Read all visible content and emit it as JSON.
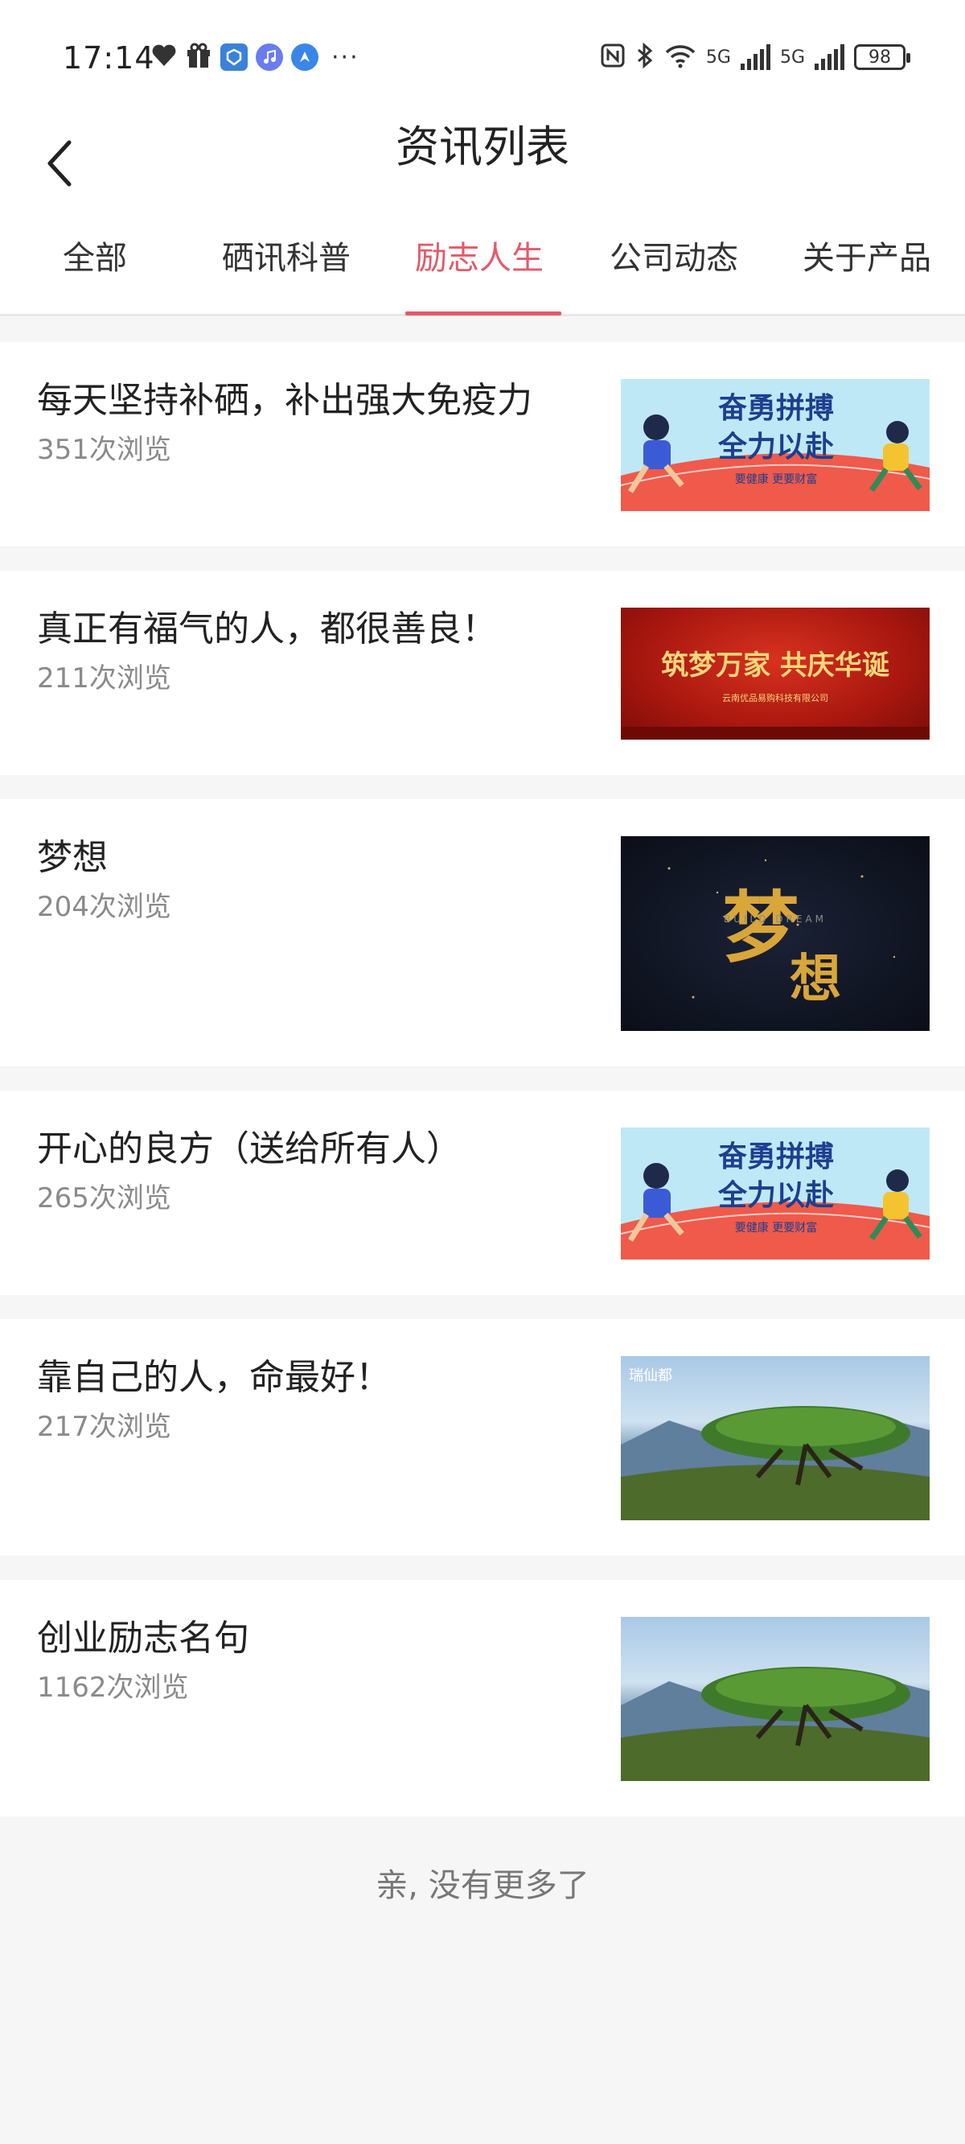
{
  "status_bar": {
    "time": "17:14",
    "battery": "98",
    "net1": "5G",
    "net2": "5G",
    "dots": "···",
    "icons": [
      "heart-icon",
      "gift-icon",
      "app-icon",
      "music-icon",
      "compass-icon",
      "nfc-icon",
      "bluetooth-icon",
      "wifi-icon",
      "signal-icon",
      "battery-icon"
    ]
  },
  "header": {
    "title": "资讯列表",
    "back_icon": "chevron-left-icon"
  },
  "tabs": [
    {
      "label": "全部",
      "active": false
    },
    {
      "label": "硒讯科普",
      "active": false
    },
    {
      "label": "励志人生",
      "active": true
    },
    {
      "label": "公司动态",
      "active": false
    },
    {
      "label": "关于产品",
      "active": false
    }
  ],
  "articles": [
    {
      "title": "每天坚持补硒，补出强大免疫力",
      "views": "351次浏览",
      "thumb": "sport",
      "thumb_text": [
        "奋勇拼搏",
        "全力以赴"
      ],
      "thumb_sub": "要健康    更要财富"
    },
    {
      "title": "真正有福气的人，都很善良！",
      "views": "211次浏览",
      "thumb": "red",
      "thumb_text": [
        "筑梦万家  共庆华诞"
      ],
      "thumb_sub": "云南优品易购科技有限公司"
    },
    {
      "title": "梦想",
      "views": "204次浏览",
      "thumb": "dream",
      "thumb_text": [
        "梦",
        "想"
      ],
      "thumb_sub": "BUILD    DREAM"
    },
    {
      "title": "开心的良方（送给所有人）",
      "views": "265次浏览",
      "thumb": "sport",
      "thumb_text": [
        "奋勇拼搏",
        "全力以赴"
      ],
      "thumb_sub": "要健康    更要财富"
    },
    {
      "title": "靠自己的人，命最好！",
      "views": "217次浏览",
      "thumb": "tree",
      "thumb_text": [
        "瑞仙都"
      ],
      "thumb_sub": ""
    },
    {
      "title": "创业励志名句",
      "views": "1162次浏览",
      "thumb": "tree",
      "thumb_text": [],
      "thumb_sub": ""
    }
  ],
  "footer": {
    "text": "亲, 没有更多了"
  },
  "colors": {
    "accent": "#e35a6a",
    "background": "#f6f6f6",
    "text": "#222222",
    "muted": "#8a8a8a"
  }
}
